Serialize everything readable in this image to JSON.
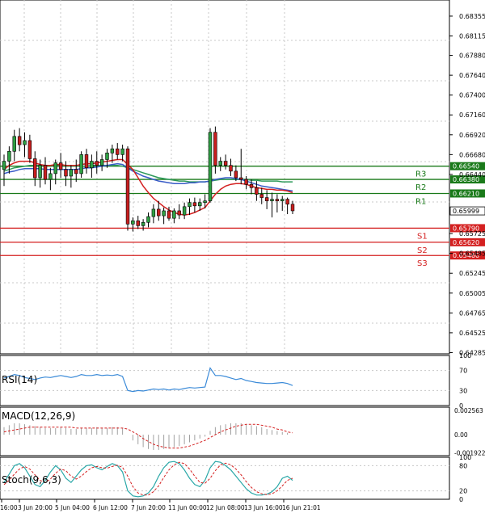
{
  "chart_data": [
    {
      "type": "candlestick",
      "symbol_indicator": "price",
      "y_ticks": [
        "0.68355",
        "0.68115",
        "0.67880",
        "0.67640",
        "0.67400",
        "0.67160",
        "0.66920",
        "0.66680",
        "0.66440",
        "0.65725",
        "0.65485",
        "0.65245",
        "0.65005",
        "0.64765",
        "0.64525",
        "0.64285"
      ],
      "ylim": [
        0.6427,
        0.6855
      ],
      "current_price": "0.65999",
      "levels": [
        {
          "name": "R3",
          "value": 0.6654,
          "label": "0.66540",
          "color": "#1a7a1a"
        },
        {
          "name": "R2",
          "value": 0.6638,
          "label": "0.66380",
          "color": "#1a7a1a"
        },
        {
          "name": "R1",
          "value": 0.6621,
          "label": "0.66210",
          "color": "#1a7a1a"
        },
        {
          "name": "S1",
          "value": 0.6579,
          "label": "0.65790",
          "color": "#d42020"
        },
        {
          "name": "S2",
          "value": 0.6562,
          "label": "0.65620",
          "color": "#d42020"
        },
        {
          "name": "S3",
          "value": 0.6546,
          "label": "0.65460",
          "color": "#d42020"
        }
      ],
      "x_labels": [
        "16:00",
        "3 Jun 20:00",
        "5 Jun 04:00",
        "6 Jun 12:00",
        "7 Jun 20:00",
        "11 Jun 00:00",
        "12 Jun 08:00",
        "13 Jun 16:00",
        "16 Jun 21:01"
      ],
      "candles": [
        [
          0.665,
          0.6668,
          0.663,
          0.666
        ],
        [
          0.666,
          0.6678,
          0.6645,
          0.6672
        ],
        [
          0.6672,
          0.6698,
          0.666,
          0.669
        ],
        [
          0.669,
          0.67,
          0.6672,
          0.668
        ],
        [
          0.668,
          0.6695,
          0.6665,
          0.6685
        ],
        [
          0.6685,
          0.6692,
          0.6658,
          0.6663
        ],
        [
          0.6663,
          0.6672,
          0.663,
          0.664
        ],
        [
          0.664,
          0.6662,
          0.6628,
          0.6655
        ],
        [
          0.6655,
          0.6665,
          0.6632,
          0.6638
        ],
        [
          0.6638,
          0.6652,
          0.6625,
          0.6645
        ],
        [
          0.6645,
          0.6662,
          0.6632,
          0.6658
        ],
        [
          0.6658,
          0.667,
          0.664,
          0.665
        ],
        [
          0.665,
          0.666,
          0.663,
          0.6642
        ],
        [
          0.6642,
          0.6655,
          0.6628,
          0.665
        ],
        [
          0.665,
          0.6662,
          0.6635,
          0.6645
        ],
        [
          0.6645,
          0.6672,
          0.664,
          0.6668
        ],
        [
          0.6668,
          0.6675,
          0.6645,
          0.6652
        ],
        [
          0.6652,
          0.6668,
          0.664,
          0.666
        ],
        [
          0.666,
          0.6672,
          0.6645,
          0.6655
        ],
        [
          0.6655,
          0.6668,
          0.6648,
          0.6662
        ],
        [
          0.6662,
          0.6675,
          0.6652,
          0.667
        ],
        [
          0.667,
          0.668,
          0.6658,
          0.6675
        ],
        [
          0.6675,
          0.6682,
          0.6662,
          0.6668
        ],
        [
          0.6668,
          0.668,
          0.666,
          0.6675
        ],
        [
          0.6675,
          0.6678,
          0.6576,
          0.6584
        ],
        [
          0.6584,
          0.6592,
          0.6575,
          0.6588
        ],
        [
          0.6588,
          0.6594,
          0.6578,
          0.6582
        ],
        [
          0.6582,
          0.659,
          0.6576,
          0.6586
        ],
        [
          0.6586,
          0.6598,
          0.658,
          0.6593
        ],
        [
          0.6593,
          0.6608,
          0.6585,
          0.6602
        ],
        [
          0.6602,
          0.6612,
          0.6588,
          0.6594
        ],
        [
          0.6594,
          0.6604,
          0.6584,
          0.66
        ],
        [
          0.66,
          0.6605,
          0.6588,
          0.6591
        ],
        [
          0.6591,
          0.6603,
          0.6585,
          0.66
        ],
        [
          0.66,
          0.6608,
          0.659,
          0.6595
        ],
        [
          0.6595,
          0.661,
          0.659,
          0.6605
        ],
        [
          0.6605,
          0.6615,
          0.6595,
          0.661
        ],
        [
          0.661,
          0.6616,
          0.6598,
          0.6606
        ],
        [
          0.6606,
          0.6615,
          0.66,
          0.661
        ],
        [
          0.661,
          0.662,
          0.6603,
          0.6612
        ],
        [
          0.6612,
          0.67,
          0.661,
          0.6695
        ],
        [
          0.6695,
          0.6702,
          0.6645,
          0.6655
        ],
        [
          0.6655,
          0.6665,
          0.6648,
          0.666
        ],
        [
          0.666,
          0.6668,
          0.665,
          0.6655
        ],
        [
          0.6655,
          0.6663,
          0.6642,
          0.6648
        ],
        [
          0.6648,
          0.6655,
          0.6636,
          0.664
        ],
        [
          0.664,
          0.6675,
          0.6632,
          0.6638
        ],
        [
          0.6638,
          0.6642,
          0.6626,
          0.6632
        ],
        [
          0.6632,
          0.6638,
          0.662,
          0.6628
        ],
        [
          0.6628,
          0.6636,
          0.6612,
          0.662
        ],
        [
          0.662,
          0.6628,
          0.6608,
          0.6616
        ],
        [
          0.6616,
          0.6625,
          0.6602,
          0.6612
        ],
        [
          0.6612,
          0.6622,
          0.6592,
          0.6614
        ],
        [
          0.6614,
          0.662,
          0.6598,
          0.6612
        ],
        [
          0.6612,
          0.6618,
          0.66,
          0.6614
        ],
        [
          0.6614,
          0.6616,
          0.6596,
          0.6608
        ],
        [
          0.6608,
          0.6612,
          0.6596,
          0.66
        ]
      ],
      "ma_red": [
        0.665,
        0.6655,
        0.6658,
        0.666,
        0.666,
        0.666,
        0.6658,
        0.6656,
        0.6655,
        0.6655,
        0.6656,
        0.6656,
        0.6655,
        0.6655,
        0.6655,
        0.6656,
        0.6657,
        0.6657,
        0.6658,
        0.6659,
        0.666,
        0.6661,
        0.6662,
        0.6662,
        0.6656,
        0.665,
        0.664,
        0.663,
        0.6622,
        0.6615,
        0.661,
        0.6605,
        0.6601,
        0.6598,
        0.6596,
        0.6595,
        0.6596,
        0.6598,
        0.6601,
        0.6604,
        0.6612,
        0.662,
        0.6626,
        0.663,
        0.6632,
        0.6633,
        0.6633,
        0.6632,
        0.663,
        0.6628,
        0.6627,
        0.6626,
        0.6626,
        0.6625,
        0.6625,
        0.6624,
        0.6622
      ],
      "ma_green": [
        0.6648,
        0.665,
        0.6652,
        0.6653,
        0.6654,
        0.6655,
        0.6655,
        0.6655,
        0.6655,
        0.6655,
        0.6655,
        0.6655,
        0.6655,
        0.6654,
        0.6654,
        0.6654,
        0.6654,
        0.6655,
        0.6655,
        0.6655,
        0.6655,
        0.6655,
        0.6655,
        0.6654,
        0.6652,
        0.665,
        0.6648,
        0.6646,
        0.6644,
        0.6642,
        0.664,
        0.6639,
        0.6638,
        0.6637,
        0.6636,
        0.6636,
        0.6635,
        0.6635,
        0.6635,
        0.6635,
        0.6636,
        0.6637,
        0.6638,
        0.6638,
        0.6638,
        0.6638,
        0.6638,
        0.6638,
        0.6637,
        0.6637,
        0.6636,
        0.6636,
        0.6636,
        0.6636,
        0.6635,
        0.6635,
        0.6635
      ],
      "ma_blue": [
        0.6645,
        0.6647,
        0.6648,
        0.665,
        0.6651,
        0.6651,
        0.6651,
        0.6651,
        0.665,
        0.665,
        0.665,
        0.665,
        0.665,
        0.665,
        0.665,
        0.6651,
        0.6652,
        0.6652,
        0.6653,
        0.6654,
        0.6655,
        0.6656,
        0.6657,
        0.6656,
        0.6652,
        0.6648,
        0.6645,
        0.6642,
        0.664,
        0.6638,
        0.6636,
        0.6635,
        0.6634,
        0.6633,
        0.6633,
        0.6633,
        0.6634,
        0.6634,
        0.6635,
        0.6635,
        0.6636,
        0.6638,
        0.6639,
        0.664,
        0.664,
        0.6639,
        0.6638,
        0.6636,
        0.6634,
        0.6632,
        0.663,
        0.6629,
        0.6628,
        0.6627,
        0.6626,
        0.6625,
        0.6624
      ]
    },
    {
      "type": "line",
      "indicator": "RSI",
      "label": "RSI(14)",
      "y_ticks": [
        "100",
        "70",
        "30",
        "0"
      ],
      "ylim": [
        0,
        100
      ],
      "values": [
        55,
        58,
        62,
        60,
        56,
        54,
        52,
        55,
        57,
        56,
        58,
        60,
        58,
        56,
        58,
        62,
        60,
        60,
        62,
        60,
        61,
        60,
        62,
        58,
        30,
        28,
        30,
        29,
        31,
        33,
        32,
        33,
        31,
        33,
        32,
        34,
        36,
        35,
        36,
        37,
        75,
        60,
        60,
        58,
        55,
        52,
        54,
        50,
        48,
        46,
        45,
        44,
        44,
        45,
        46,
        44,
        40
      ]
    },
    {
      "type": "bar+line",
      "indicator": "MACD",
      "label": "MACD(12,26,9)",
      "y_ticks": [
        "0.002563",
        "0.00",
        "-0.001922"
      ],
      "ylim": [
        -0.0022,
        0.0029
      ],
      "histogram": [
        0.0008,
        0.001,
        0.0012,
        0.0012,
        0.0011,
        0.001,
        0.0009,
        0.0008,
        0.0007,
        0.0007,
        0.0007,
        0.0008,
        0.0007,
        0.0006,
        0.0006,
        0.0007,
        0.0007,
        0.0007,
        0.0008,
        0.0007,
        0.0007,
        0.0008,
        0.0008,
        0.0007,
        0.0,
        -0.0006,
        -0.001,
        -0.0013,
        -0.0015,
        -0.0016,
        -0.0016,
        -0.0015,
        -0.0014,
        -0.0013,
        -0.0012,
        -0.001,
        -0.0008,
        -0.0006,
        -0.0004,
        -0.0002,
        0.0004,
        0.0008,
        0.001,
        0.0011,
        0.0012,
        0.0012,
        0.0012,
        0.0011,
        0.001,
        0.0009,
        0.0008,
        0.0006,
        0.0005,
        0.0004,
        0.0003,
        0.0002,
        0.0
      ],
      "signal": [
        0.0003,
        0.0004,
        0.0005,
        0.0006,
        0.0007,
        0.0008,
        0.0008,
        0.0008,
        0.0008,
        0.0008,
        0.0008,
        0.0008,
        0.0008,
        0.0008,
        0.0007,
        0.0007,
        0.0007,
        0.0007,
        0.0007,
        0.0007,
        0.0007,
        0.0007,
        0.0007,
        0.0007,
        0.0006,
        0.0003,
        0.0,
        -0.0004,
        -0.0007,
        -0.001,
        -0.0012,
        -0.0013,
        -0.0014,
        -0.0014,
        -0.0014,
        -0.0013,
        -0.0012,
        -0.001,
        -0.0008,
        -0.0006,
        -0.0003,
        0.0,
        0.0003,
        0.0005,
        0.0007,
        0.0009,
        0.001,
        0.0011,
        0.0011,
        0.0011,
        0.001,
        0.0009,
        0.0008,
        0.0006,
        0.0005,
        0.0003,
        0.0002
      ]
    },
    {
      "type": "line",
      "indicator": "Stochastic",
      "label": "Stoch(9,6,3)",
      "y_ticks": [
        "100",
        "80",
        "20",
        "0"
      ],
      "ylim": [
        0,
        100
      ],
      "main": [
        40,
        60,
        80,
        85,
        75,
        55,
        35,
        30,
        45,
        65,
        80,
        70,
        50,
        40,
        55,
        70,
        80,
        82,
        75,
        70,
        78,
        85,
        80,
        65,
        20,
        8,
        6,
        8,
        15,
        30,
        55,
        75,
        88,
        90,
        85,
        70,
        50,
        35,
        30,
        45,
        75,
        90,
        88,
        80,
        70,
        55,
        40,
        25,
        15,
        10,
        10,
        12,
        18,
        30,
        50,
        55,
        45
      ],
      "signal": [
        35,
        45,
        60,
        72,
        78,
        72,
        58,
        45,
        40,
        48,
        62,
        72,
        68,
        55,
        48,
        55,
        66,
        75,
        78,
        75,
        74,
        78,
        81,
        76,
        55,
        30,
        15,
        10,
        10,
        18,
        32,
        52,
        70,
        82,
        88,
        85,
        72,
        55,
        40,
        38,
        50,
        68,
        82,
        86,
        82,
        72,
        58,
        42,
        28,
        18,
        13,
        11,
        13,
        20,
        32,
        45,
        50
      ]
    }
  ]
}
